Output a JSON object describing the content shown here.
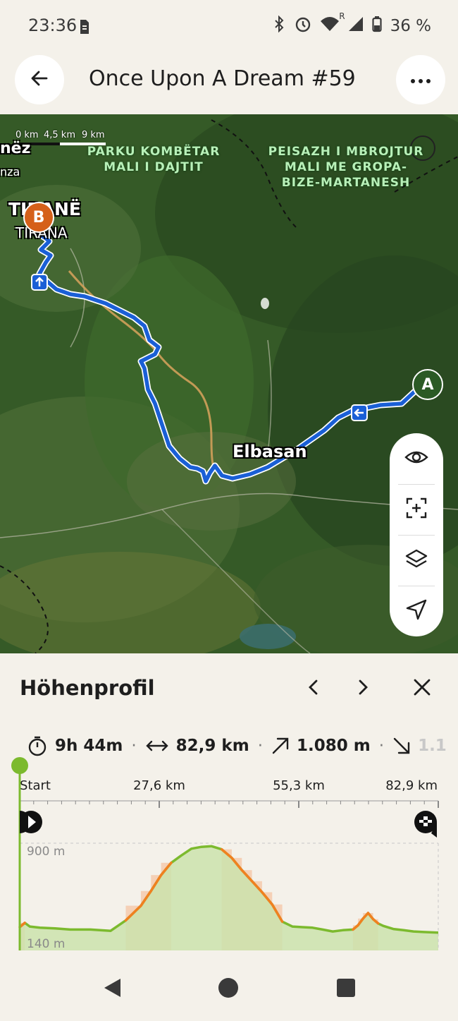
{
  "status_bar": {
    "time": "23:36",
    "battery": "36 %",
    "roaming": "R",
    "icons": [
      "sim-icon",
      "bluetooth-icon",
      "alarm-icon",
      "wifi-icon",
      "signal-icon",
      "battery-icon"
    ]
  },
  "header": {
    "title": "Once Upon A Dream #59",
    "back_icon": "arrow-left-icon",
    "more_icon": "more-horizontal-icon"
  },
  "map": {
    "scale_labels": [
      "0 km",
      "4,5 km",
      "9 km"
    ],
    "area_labels": [
      [
        "PARKU KOMBËTAR",
        "MALI I DAJTIT"
      ],
      [
        "PEISAZH I MBROJTUR",
        "MALI ME GROPA-",
        "BIZE-MARTANESH"
      ]
    ],
    "partial_labels": [
      "nëz",
      "nza"
    ],
    "cities": {
      "tirana": "TIRANË",
      "tirana_sub": "TIRANA",
      "elbasan": "Elbasan"
    },
    "markers": {
      "start": "A",
      "end": "B"
    },
    "route_color": "#1a5fd6",
    "controls": [
      "eye-icon",
      "zoom-to-route-icon",
      "layers-icon",
      "navigate-icon"
    ]
  },
  "elevation": {
    "title": "Höhenprofil",
    "prev_icon": "chevron-left-icon",
    "next_icon": "chevron-right-icon",
    "close_icon": "close-icon",
    "stats": {
      "duration": "9h 44m",
      "distance": "82,9 km",
      "ascent": "1.080 m",
      "descent": "1.1"
    },
    "x_ticks": [
      "Start",
      "27,6 km",
      "55,3 km",
      "82,9 km"
    ],
    "y_labels": [
      "900 m",
      "140 m"
    ],
    "line_color": "#7cba2e",
    "steep_color": "#f08020"
  },
  "chart_data": {
    "type": "area",
    "title": "Höhenprofil",
    "xlabel": "",
    "ylabel": "",
    "x_unit": "km",
    "y_unit": "m",
    "xlim": [
      0,
      82.9
    ],
    "ylim": [
      140,
      900
    ],
    "x": [
      0,
      1,
      2,
      4,
      7,
      10,
      14,
      18,
      21,
      24,
      26,
      28,
      30,
      32,
      34,
      36,
      38,
      40,
      42,
      44,
      46,
      48,
      50,
      52,
      54,
      56,
      58,
      60,
      62,
      64,
      66,
      67,
      68,
      69,
      70,
      71,
      72,
      74,
      76,
      78,
      80,
      82.9
    ],
    "series": [
      {
        "values": [
          215,
          250,
          220,
          210,
          205,
          195,
          195,
          185,
          270,
          390,
          510,
          640,
          740,
          800,
          855,
          870,
          875,
          850,
          780,
          680,
          590,
          500,
          400,
          260,
          220,
          215,
          210,
          195,
          180,
          190,
          195,
          230,
          285,
          330,
          280,
          245,
          225,
          200,
          190,
          180,
          175,
          170
        ]
      }
    ]
  },
  "nav_bar": {
    "icons": [
      "nav-back-icon",
      "nav-home-icon",
      "nav-recents-icon"
    ]
  }
}
